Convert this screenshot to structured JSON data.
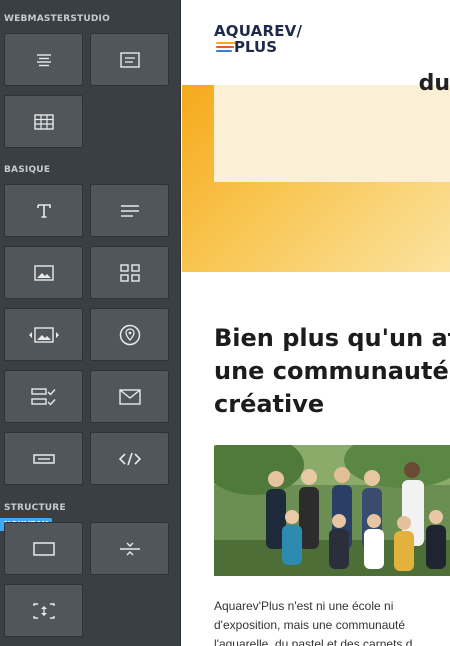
{
  "sidebar": {
    "sections": {
      "webmasterstudio": "WEBMASTERSTUDIO",
      "basique": "BASIQUE",
      "structure": "STRUCTURE"
    },
    "badge": "NOUVEAU",
    "icons": {
      "webmaster": [
        "text-block-icon",
        "boxed-text-icon",
        "table-icon"
      ],
      "basique": [
        "text-icon",
        "paragraph-icon",
        "image-icon",
        "gallery-icon",
        "image-carousel-icon",
        "map-pin-icon",
        "form-checklist-icon",
        "email-icon",
        "button-icon",
        "code-icon"
      ],
      "structure": [
        "container-icon",
        "divider-icon",
        "spacer-icon"
      ]
    }
  },
  "preview": {
    "logo_line1": "AQUAREV/",
    "logo_line2": "PLUS",
    "hero_text": "du",
    "heading_lines": [
      "Bien plus qu'un at",
      "une communauté",
      "créative"
    ],
    "paragraph_lines": [
      "Aquarev'Plus n'est ni une école ni",
      "d'exposition, mais une communauté",
      "l'aquarelle, du pastel et des carnets d"
    ]
  },
  "colors": {
    "sidebar_bg": "#3a3f44",
    "tile_bg": "#505659",
    "badge": "#3fa9f5",
    "hero_orange": "#f6a91b"
  }
}
